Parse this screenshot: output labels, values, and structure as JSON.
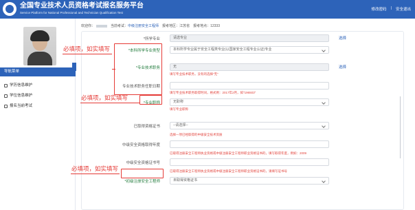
{
  "header": {
    "title": "全国专业技术人员资格考试报名服务平台",
    "subtitle": "Service Platform for National Professional and Technician Qualification Test",
    "links": [
      {
        "label": "修改密码"
      },
      {
        "label": "安全退出"
      }
    ],
    "separator": "|"
  },
  "info_bar": {
    "welcome": "欢迎你：",
    "exam_label": "当前考试：",
    "exam_value": "中级注册安全工程师",
    "region_label": "报考地区：",
    "region_value": "江苏省",
    "site_label": "报考地点：",
    "site_value": "12333"
  },
  "sidebar": {
    "nav_header": "导航菜单",
    "items": [
      {
        "label": "学历信息维护",
        "icon": "book-icon"
      },
      {
        "label": "学位信息维护",
        "icon": "cap-icon"
      },
      {
        "label": "报名当前考试",
        "icon": "clipboard-icon"
      }
    ]
  },
  "form": {
    "rows": [
      {
        "label": "*所学专业",
        "required": false,
        "value": "请选专业",
        "kind": "gray",
        "action": "选择"
      },
      {
        "label": "*本科所学专业类型",
        "required": true,
        "value": "本科所学专业属于安全工程类专业(以国家安全工程专业认证)专业",
        "kind": "select"
      },
      {
        "label": "*专业技术职务",
        "required": true,
        "value": "无",
        "kind": "gray",
        "action": "选择",
        "hint": "填写专业技术职务，没有的选择\"无\""
      },
      {
        "label": "专业技术职务任职日期",
        "required": false,
        "value": "",
        "kind": "text",
        "hint": "填写专业技术职务取得时间，格式例：2017年2月，如\"196503\""
      },
      {
        "label": "*专业职称",
        "required": true,
        "value": "无职称",
        "kind": "select",
        "hint": "填写专业职称"
      },
      {
        "label": "已取得资格证书",
        "required": false,
        "value": "--请选择--",
        "kind": "select",
        "hint": "选择一项已经取得的中级安全技术资质"
      },
      {
        "label": "中级安全资格取得年度",
        "required": false,
        "value": "",
        "kind": "text",
        "hint": "已取得注册安全工程师执业资格或中级注册安全工程师职业资格证书的，填写取得年度，例如：2009"
      },
      {
        "label": "中级安全资格证书号",
        "required": false,
        "value": "",
        "kind": "text",
        "hint": "已取得注册安全工程师执业资格或中级注册安全工程师职业资格证书的，请填写证书号"
      },
      {
        "label": "*初级注册安全工程师",
        "required": true,
        "value": "未取得资格证书",
        "kind": "select"
      }
    ]
  },
  "annotations": {
    "required_note": "必填项，如实填写",
    "color": "#e53935"
  },
  "colors": {
    "brand": "#2d63b9",
    "required_label": "#1f7a3a",
    "hint": "#e2443d"
  }
}
